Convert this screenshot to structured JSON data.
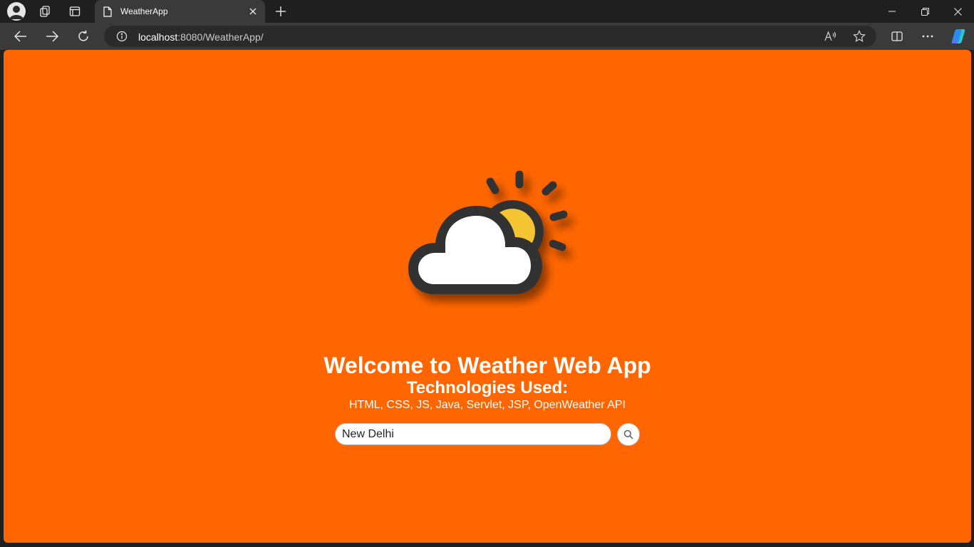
{
  "browser": {
    "tab": {
      "title": "WeatherApp"
    },
    "address": {
      "host": "localhost",
      "rest": ":8080/WeatherApp/"
    },
    "icons": {
      "profile": "profile-icon",
      "workspaces": "workspaces-icon",
      "tab_actions": "tab-actions-icon",
      "page": "page-icon",
      "close": "close-icon",
      "new_tab": "plus-icon",
      "back": "back-arrow-icon",
      "forward": "forward-arrow-icon",
      "refresh": "refresh-icon",
      "info": "info-icon",
      "read_aloud": "read-aloud-icon",
      "favorite": "star-icon",
      "split": "split-screen-icon",
      "more": "more-icon",
      "copilot": "copilot-icon"
    }
  },
  "page": {
    "background_color": "#ff6600",
    "heading": "Welcome to Weather Web App",
    "subheading": "Technologies Used:",
    "technologies": "HTML, CSS, JS, Java, Servlet, JSP, OpenWeather API",
    "search": {
      "value": "New Delhi"
    },
    "icons": {
      "weather": "partly-cloudy-icon",
      "search": "search-icon"
    }
  }
}
